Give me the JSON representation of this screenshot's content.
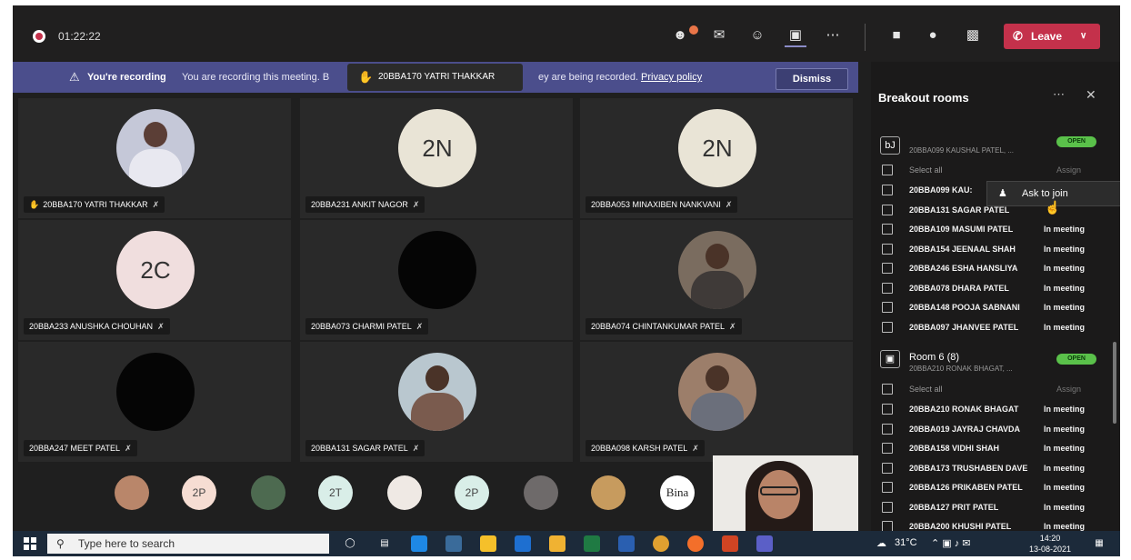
{
  "topbar": {
    "timer": "01:22:22",
    "icons": [
      "participants-icon",
      "chat-icon",
      "reactions-icon",
      "breakout-rooms-icon",
      "more-icon",
      "camera-icon",
      "mic-icon",
      "share-icon"
    ],
    "leave_label": "Leave"
  },
  "banner": {
    "title": "You're recording",
    "text_a": "You are recording this meeting. B",
    "text_b": "ey are being recorded.",
    "privacy_link": "Privacy policy",
    "dismiss_label": "Dismiss",
    "hand_raised_name": "20BBA170 YATRI THAKKAR"
  },
  "tiles": [
    {
      "name": "20BBA170 YATRI THAKKAR",
      "initials": "",
      "hand": true
    },
    {
      "name": "20BBA231 ANKIT NAGOR",
      "initials": "2N",
      "hand": false
    },
    {
      "name": "20BBA053 MINAXIBEN NANKVANI",
      "initials": "2N",
      "hand": false
    },
    {
      "name": "20BBA233 ANUSHKA CHOUHAN",
      "initials": "2C",
      "hand": false
    },
    {
      "name": "20BBA073 CHARMI PATEL",
      "initials": "",
      "hand": false
    },
    {
      "name": "20BBA074 CHINTANKUMAR PATEL",
      "initials": "",
      "hand": false
    },
    {
      "name": "20BBA247 MEET PATEL",
      "initials": "",
      "hand": false
    },
    {
      "name": "20BBA131 SAGAR PATEL",
      "initials": "",
      "hand": false
    },
    {
      "name": "20BBA098 KARSH PATEL",
      "initials": "",
      "hand": false
    }
  ],
  "strip": {
    "initials": [
      "2P",
      "2T",
      "2P",
      "Bina"
    ]
  },
  "panel": {
    "title": "Breakout rooms",
    "room5_short": "bJ",
    "room5_sub": "20BBA099 KAUSHAL PATEL, ...",
    "open_label": "OPEN",
    "select_all": "Select all",
    "assign_label": "Assign",
    "room5_members": [
      {
        "name": "20BBA099 KAU:",
        "status": ""
      },
      {
        "name": "20BBA131 SAGAR PATEL",
        "status": ""
      },
      {
        "name": "20BBA109 MASUMI PATEL",
        "status": "In meeting"
      },
      {
        "name": "20BBA154 JEENAAL SHAH",
        "status": "In meeting"
      },
      {
        "name": "20BBA246 ESHA HANSLIYA",
        "status": "In meeting"
      },
      {
        "name": "20BBA078 DHARA PATEL",
        "status": "In meeting"
      },
      {
        "name": "20BBA148 POOJA SABNANI",
        "status": "In meeting"
      },
      {
        "name": "20BBA097 JHANVEE PATEL",
        "status": "In meeting"
      }
    ],
    "room6_title": "Room 6 (8)",
    "room6_sub": "20BBA210 RONAK BHAGAT, ...",
    "room6_members": [
      {
        "name": "20BBA210 RONAK BHAGAT",
        "status": "In meeting"
      },
      {
        "name": "20BBA019 JAYRAJ CHAVDA",
        "status": "In meeting"
      },
      {
        "name": "20BBA158 VIDHI SHAH",
        "status": "In meeting"
      },
      {
        "name": "20BBA173 TRUSHABEN DAVE",
        "status": "In meeting"
      },
      {
        "name": "20BBA126 PRIKABEN PATEL",
        "status": "In meeting"
      },
      {
        "name": "20BBA127 PRIT PATEL",
        "status": "In meeting"
      },
      {
        "name": "20BBA200 KHUSHI PATEL",
        "status": "In meeting"
      }
    ],
    "popup_label": "Ask to join"
  },
  "taskbar": {
    "search_placeholder": "Type here to search",
    "temperature": "31°C",
    "time": "14:20",
    "date": "13-08-2021"
  }
}
